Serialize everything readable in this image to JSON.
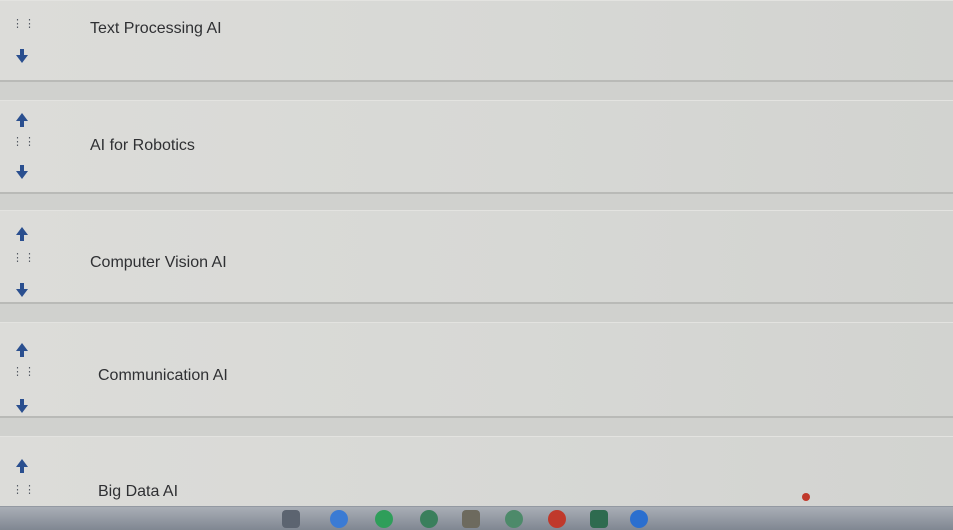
{
  "list": {
    "items": [
      {
        "label": "Text Processing AI"
      },
      {
        "label": "AI for Robotics"
      },
      {
        "label": "Computer Vision AI"
      },
      {
        "label": "Communication AI"
      },
      {
        "label": "Big Data AI"
      }
    ]
  },
  "icons": {
    "up": "arrow-up-icon",
    "down": "arrow-down-icon",
    "drag": "drag-handle-icon"
  },
  "colors": {
    "arrow": "#2a4f8f",
    "text": "#2f3033",
    "background": "#d7d8d5"
  }
}
